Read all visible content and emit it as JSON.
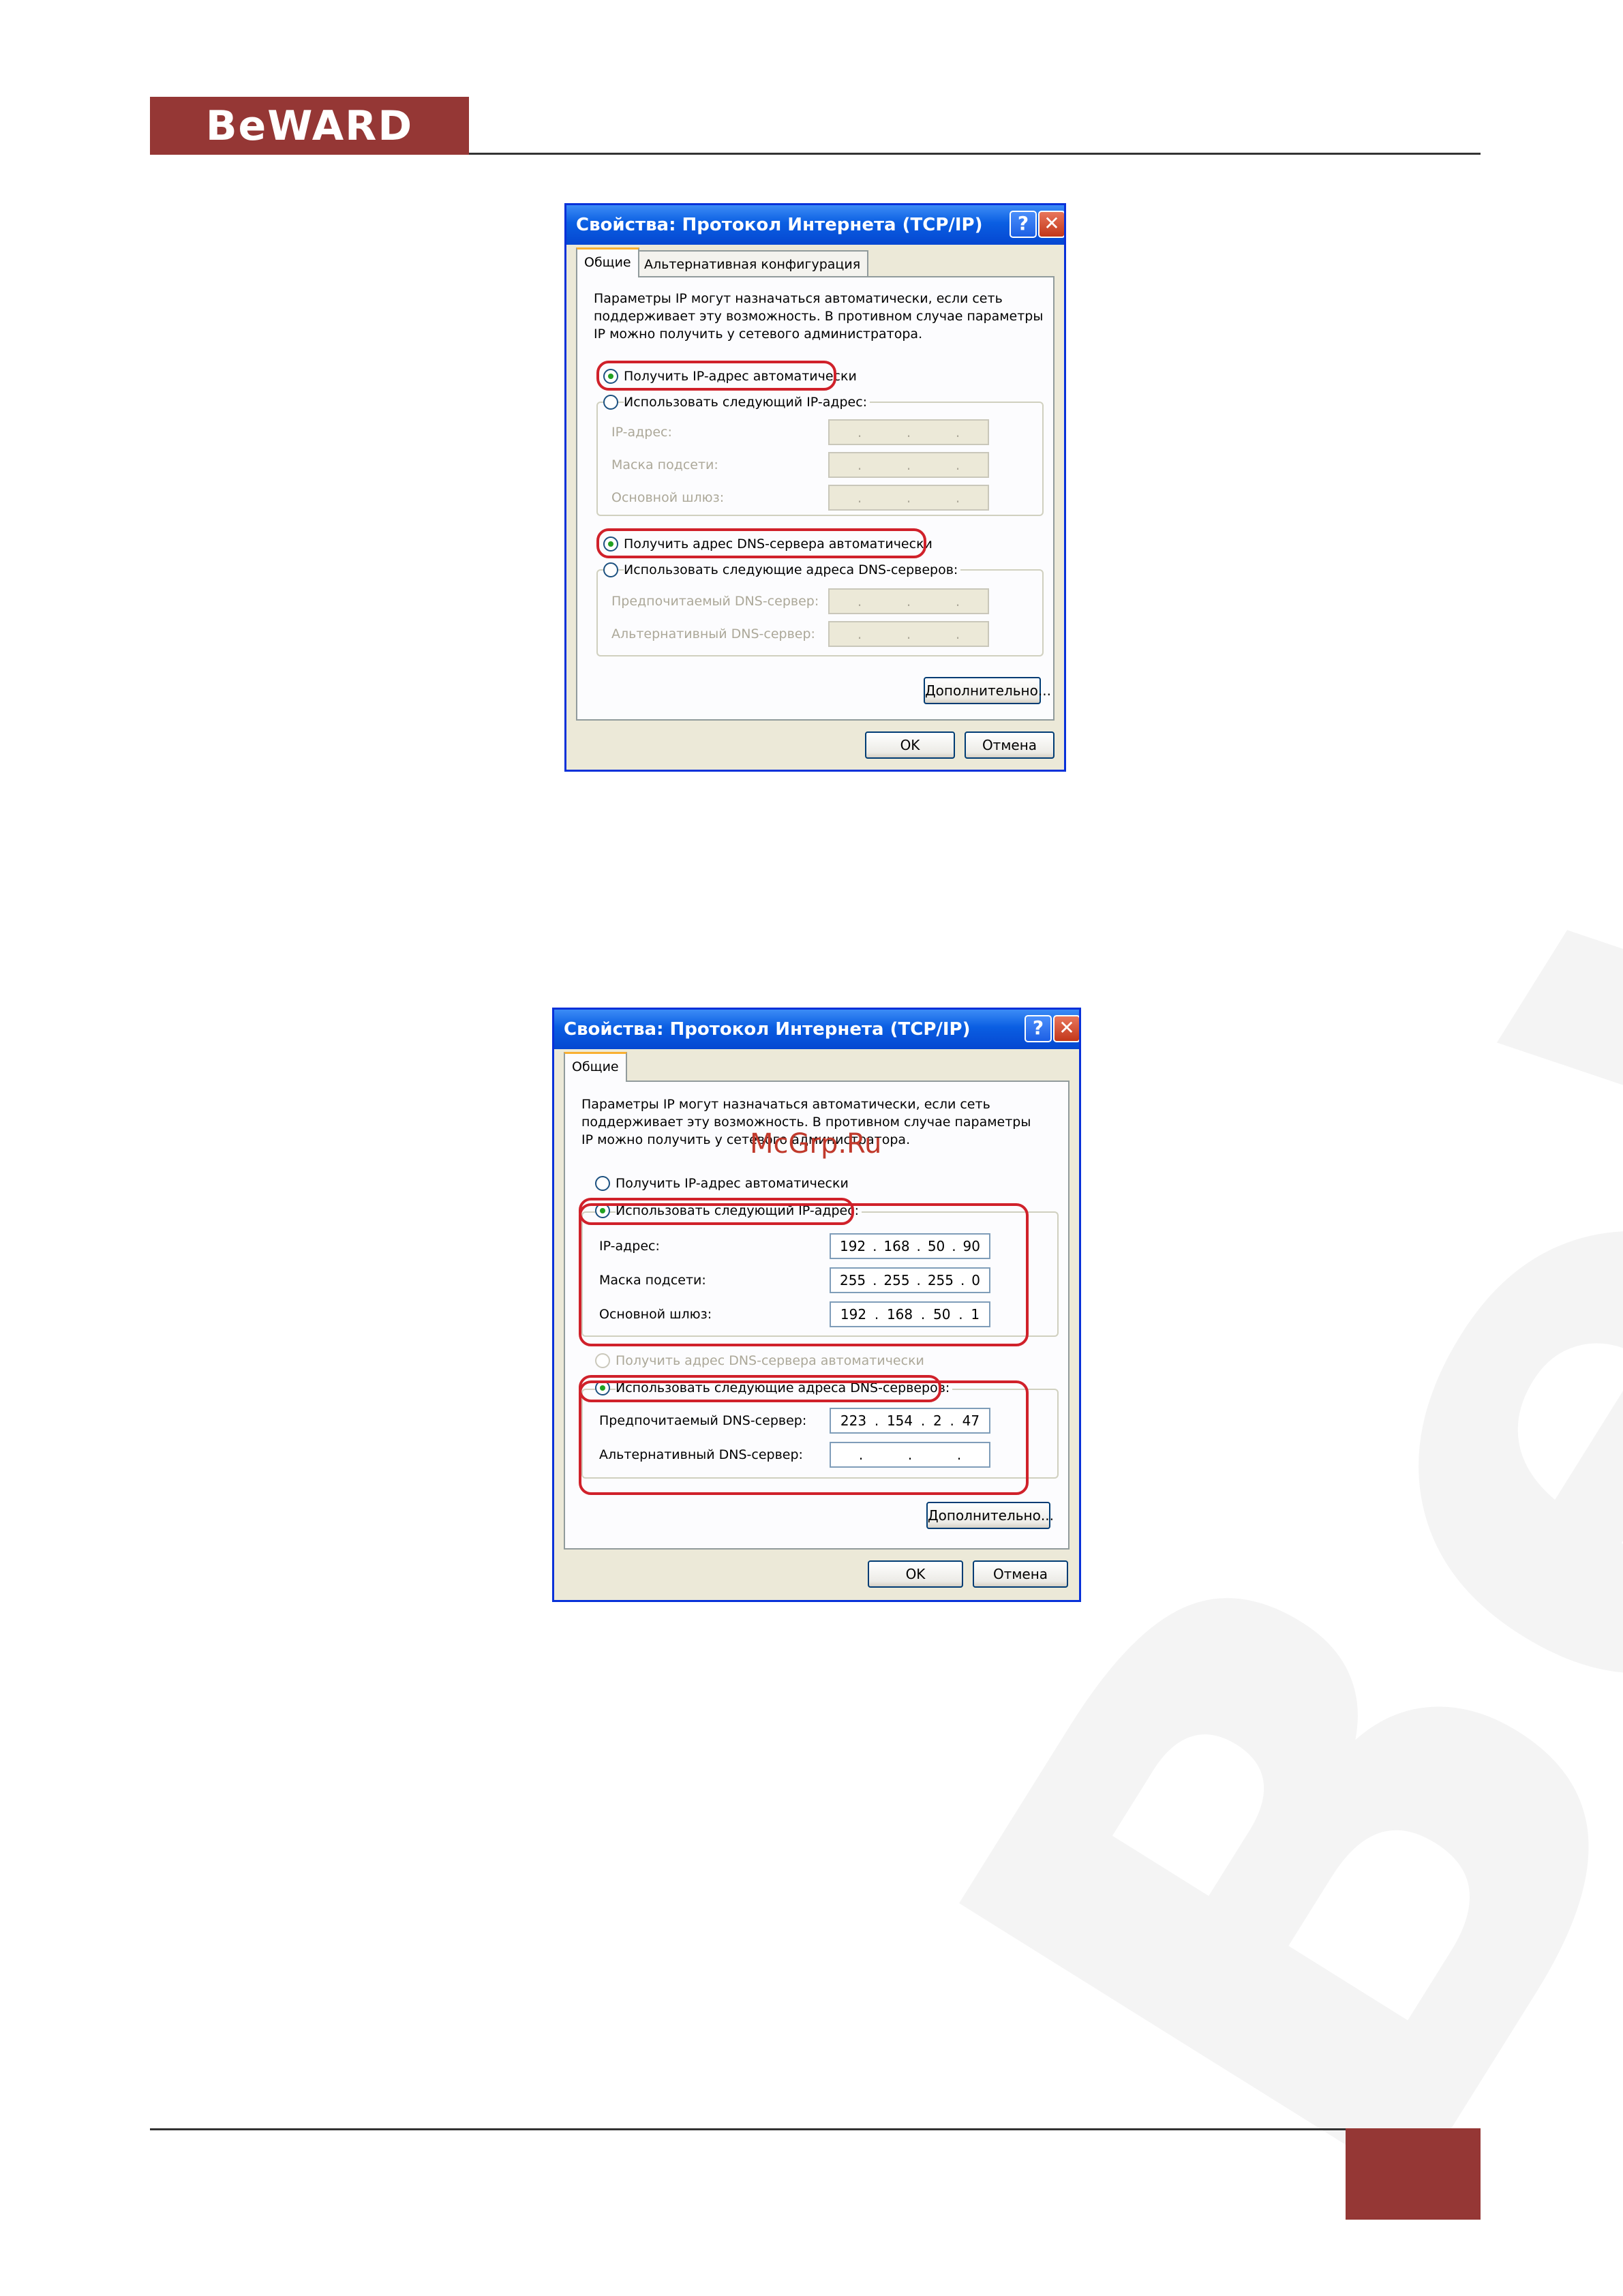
{
  "brand": {
    "logo_text": "BeWARD",
    "watermark_text": "BeWARD"
  },
  "site_mark": "McGrp.Ru",
  "dialog1": {
    "title": "Свойства: Протокол Интернета (TCP/IP)",
    "help_glyph": "?",
    "close_glyph": "✕",
    "tabs": [
      "Общие",
      "Альтернативная конфигурация"
    ],
    "description": [
      "Параметры IP могут назначаться автоматически, если сеть",
      "поддерживает эту возможность. В противном случае параметры",
      "IP можно получить у сетевого администратора."
    ],
    "radio_ip_auto": "Получить IP-адрес автоматически",
    "radio_ip_manual": "Использовать следующий IP-адрес:",
    "ip_label": "IP-адрес:",
    "mask_label": "Маска подсети:",
    "gateway_label": "Основной шлюз:",
    "radio_dns_auto": "Получить адрес DNS-сервера автоматически",
    "radio_dns_manual": "Использовать следующие адреса DNS-серверов:",
    "dns_pref_label": "Предпочитаемый DNS-сервер:",
    "dns_alt_label": "Альтернативный DNS-сервер:",
    "advanced_button": "Дополнительно...",
    "ok_button": "OK",
    "cancel_button": "Отмена"
  },
  "dialog2": {
    "title": "Свойства: Протокол Интернета (TCP/IP)",
    "help_glyph": "?",
    "close_glyph": "✕",
    "tabs": [
      "Общие"
    ],
    "description": [
      "Параметры IP могут назначаться автоматически, если сеть",
      "поддерживает эту возможность. В противном случае параметры",
      "IP можно получить у сетевого администратора."
    ],
    "radio_ip_auto": "Получить IP-адрес автоматически",
    "radio_ip_manual": "Использовать следующий IP-адрес:",
    "ip_label": "IP-адрес:",
    "ip_value": [
      "192",
      "168",
      "50",
      "90"
    ],
    "mask_label": "Маска подсети:",
    "mask_value": [
      "255",
      "255",
      "255",
      "0"
    ],
    "gateway_label": "Основной шлюз:",
    "gateway_value": [
      "192",
      "168",
      "50",
      "1"
    ],
    "radio_dns_auto": "Получить адрес DNS-сервера автоматически",
    "radio_dns_manual": "Использовать следующие адреса DNS-серверов:",
    "dns_pref_label": "Предпочитаемый DNS-сервер:",
    "dns_pref_value": [
      "223",
      "154",
      "2",
      "47"
    ],
    "dns_alt_label": "Альтернативный DNS-сервер:",
    "advanced_button": "Дополнительно...",
    "ok_button": "OK",
    "cancel_button": "Отмена"
  },
  "colors": {
    "brand_red": "#953735",
    "highlight_red": "#d0212a",
    "xp_blue": "#0a5ee2",
    "dialog_bg": "#ece9d8"
  }
}
